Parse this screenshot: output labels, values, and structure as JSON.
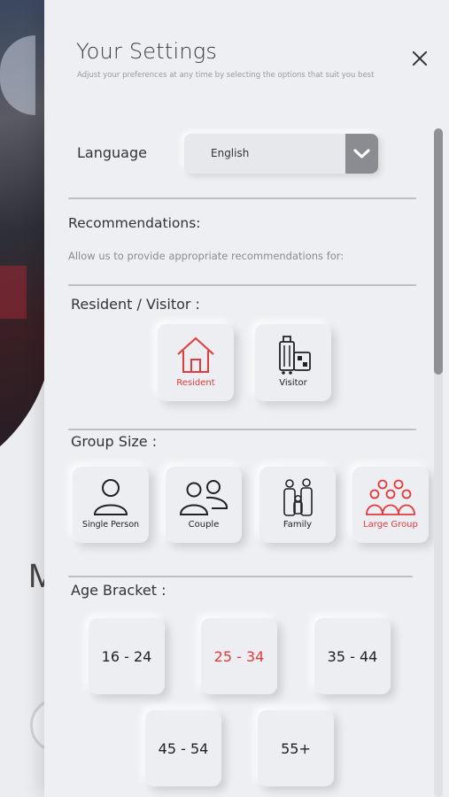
{
  "background": {
    "partial_heading": "M"
  },
  "header": {
    "title": "Your Settings",
    "subtitle": "Adjust your preferences at any time by selecting the options that suit you best"
  },
  "language": {
    "label": "Language",
    "selected": "English"
  },
  "recommendations": {
    "heading": "Recommendations:",
    "note": "Allow us to provide appropriate recommendations for:"
  },
  "resident_visitor": {
    "label": "Resident / Visitor :",
    "options": [
      {
        "label": "Resident",
        "icon": "house-icon",
        "selected": true
      },
      {
        "label": "Visitor",
        "icon": "luggage-icon",
        "selected": false
      }
    ]
  },
  "group_size": {
    "label": "Group Size :",
    "options": [
      {
        "label": "Single Person",
        "icon": "single-person-icon",
        "selected": false
      },
      {
        "label": "Couple",
        "icon": "couple-icon",
        "selected": false
      },
      {
        "label": "Family",
        "icon": "family-icon",
        "selected": false
      },
      {
        "label": "Large Group",
        "icon": "large-group-icon",
        "selected": true
      }
    ]
  },
  "age_bracket": {
    "label": "Age Bracket :",
    "options": [
      {
        "label": "16 - 24",
        "selected": false
      },
      {
        "label": "25 - 34",
        "selected": true
      },
      {
        "label": "35 - 44",
        "selected": false
      },
      {
        "label": "45 - 54",
        "selected": false
      },
      {
        "label": "55+",
        "selected": false
      }
    ]
  },
  "colors": {
    "accent": "#e23b3b",
    "text": "#222222",
    "panel": "#edeff2"
  }
}
